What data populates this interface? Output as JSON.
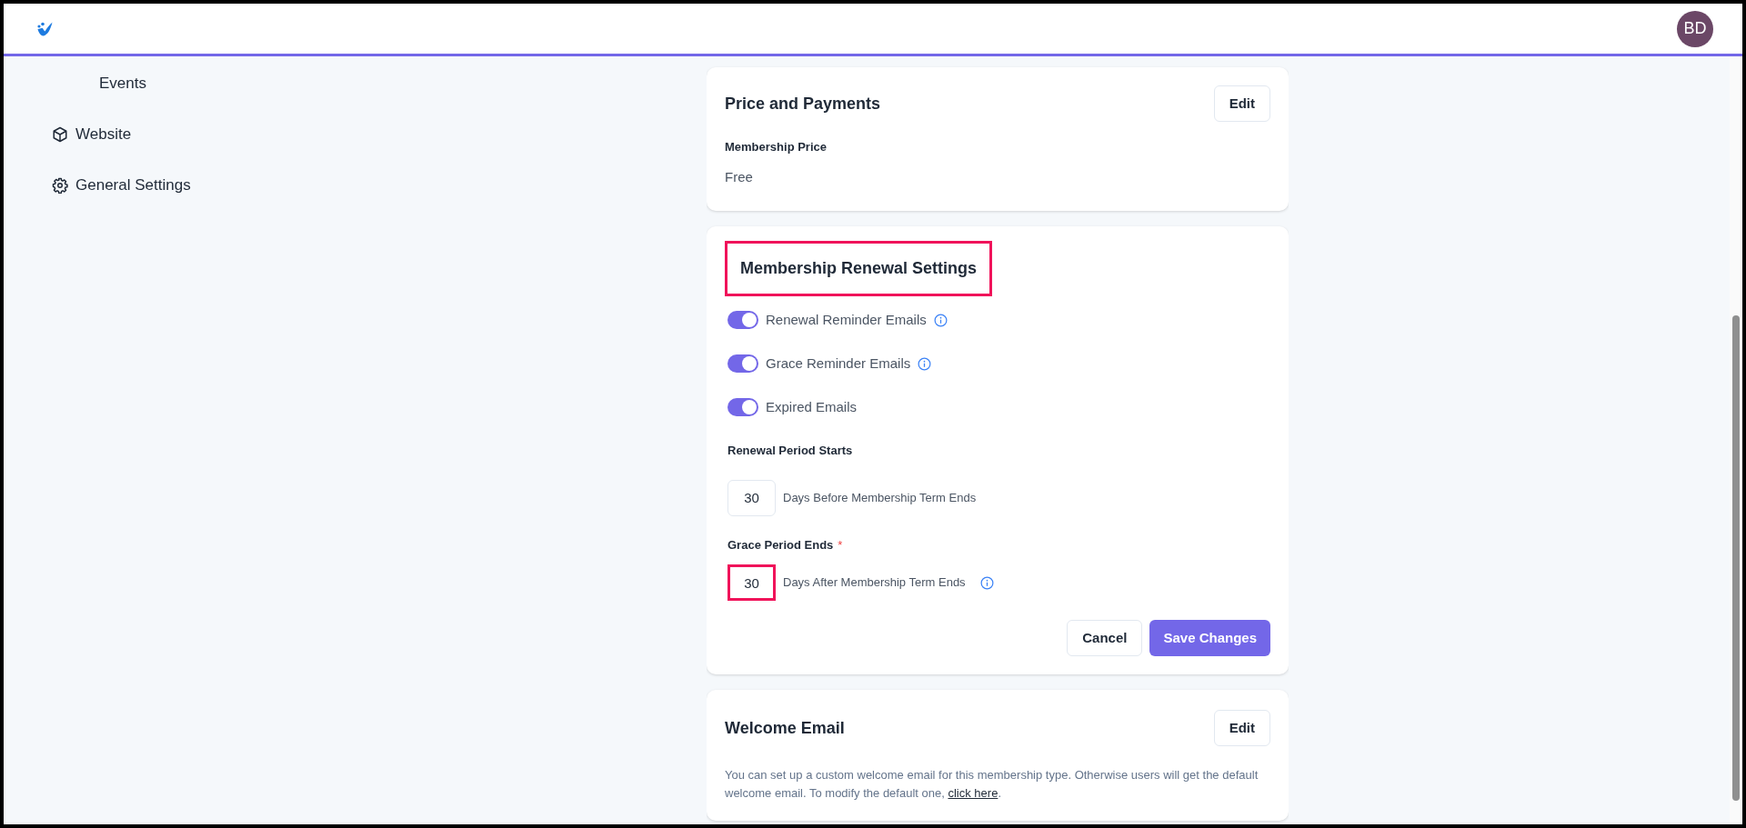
{
  "header": {
    "avatar_initials": "BD"
  },
  "sidebar": {
    "items": [
      {
        "label": "Events",
        "kind": "plain"
      },
      {
        "label": "Website",
        "kind": "box"
      },
      {
        "label": "General Settings",
        "kind": "gear"
      }
    ]
  },
  "price_card": {
    "title": "Price and Payments",
    "edit_button": "Edit",
    "field_label": "Membership Price",
    "field_value": "Free"
  },
  "renewal_card": {
    "title": "Membership Renewal Settings",
    "title_highlighted": true,
    "toggles": [
      {
        "label": "Renewal Reminder Emails",
        "on": true,
        "info": true
      },
      {
        "label": "Grace Reminder Emails",
        "on": true,
        "info": true
      },
      {
        "label": "Expired Emails",
        "on": true,
        "info": false
      }
    ],
    "periods": [
      {
        "label": "Renewal Period Starts",
        "required": false,
        "value": "30",
        "suffix": "Days Before Membership Term Ends",
        "info": false,
        "highlighted": false
      },
      {
        "label": "Grace Period Ends",
        "required": true,
        "value": "30",
        "suffix": "Days After Membership Term Ends",
        "info": true,
        "highlighted": true
      }
    ],
    "required_mark": "*",
    "cancel_button": "Cancel",
    "save_button": "Save Changes"
  },
  "welcome_card": {
    "title": "Welcome Email",
    "edit_button": "Edit",
    "description": "You can set up a custom welcome email for this membership type. Otherwise users will get the default welcome email. To modify the default one, ",
    "link": "click here",
    "description_end": "."
  }
}
